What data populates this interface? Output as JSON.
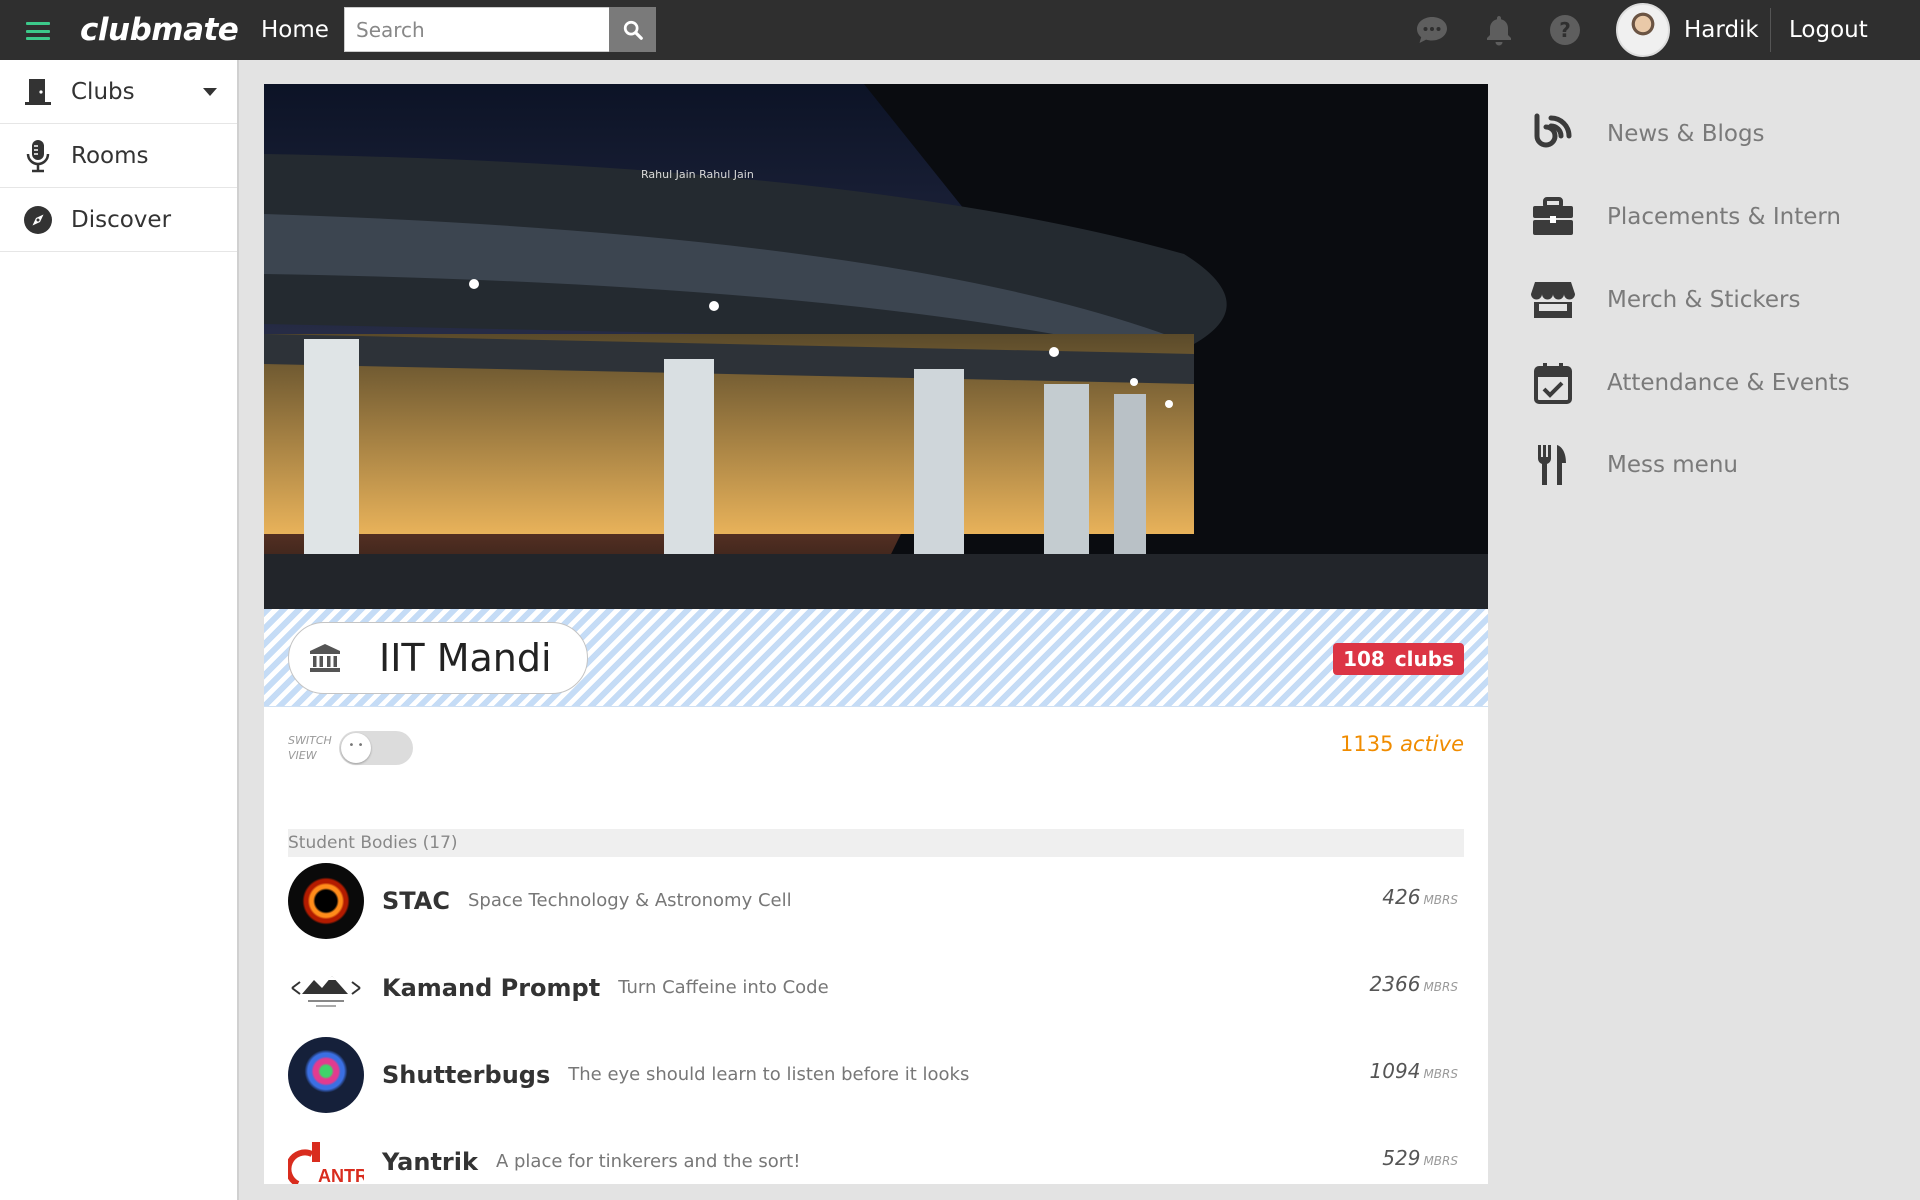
{
  "header": {
    "logo": "clubmate",
    "home_label": "Home",
    "search_placeholder": "Search",
    "username": "Hardik",
    "logout_label": "Logout",
    "icons": [
      "hamburger-icon",
      "search-icon",
      "chat-icon",
      "bell-icon",
      "help-icon"
    ]
  },
  "sidebar": {
    "items": [
      {
        "label": "Clubs",
        "icon": "door-icon",
        "has_dropdown": true
      },
      {
        "label": "Rooms",
        "icon": "microphone-icon"
      },
      {
        "label": "Discover",
        "icon": "compass-icon"
      }
    ]
  },
  "college": {
    "photo_credit": "Rahul Jain Rahul Jain",
    "name": "IIT Mandi",
    "clubs_count": "108",
    "clubs_label": "clubs",
    "switch_label_1": "SWITCH",
    "switch_label_2": "VIEW",
    "active_count": "1135",
    "active_label": "active"
  },
  "section": {
    "title": "Student Bodies (17)",
    "clubs": [
      {
        "name": "STAC",
        "description": "Space Technology & Astronomy Cell",
        "members": "426",
        "members_unit": "MBRS"
      },
      {
        "name": "Kamand Prompt",
        "description": "Turn Caffeine into Code",
        "members": "2366",
        "members_unit": "MBRS"
      },
      {
        "name": "Shutterbugs",
        "description": "The eye should learn to listen before it looks",
        "members": "1094",
        "members_unit": "MBRS"
      },
      {
        "name": "Yantrik",
        "description": "A place for tinkerers and the sort!",
        "members": "529",
        "members_unit": "MBRS"
      }
    ]
  },
  "right_panel": {
    "items": [
      {
        "label": "News & Blogs",
        "icon": "blog-feed-icon"
      },
      {
        "label": "Placements & Intern",
        "icon": "briefcase-icon"
      },
      {
        "label": "Merch & Stickers",
        "icon": "store-icon"
      },
      {
        "label": "Attendance & Events",
        "icon": "calendar-check-icon"
      },
      {
        "label": "Mess menu",
        "icon": "utensils-icon"
      }
    ]
  },
  "colors": {
    "topbar": "#2f2f2f",
    "accent_green": "#3cc98a",
    "badge_red": "#dc3545",
    "active_orange": "#f08c00"
  }
}
